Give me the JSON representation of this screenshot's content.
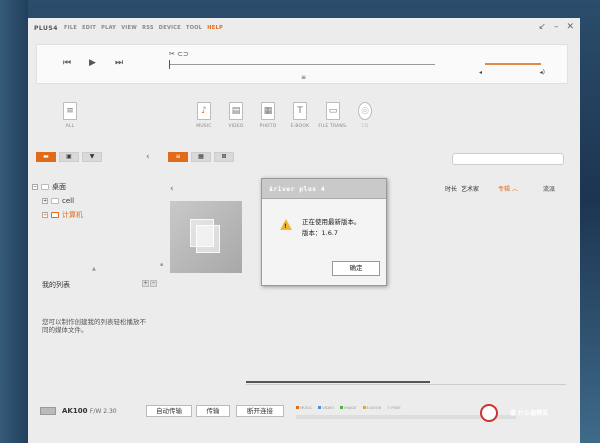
{
  "app": {
    "brand": "PLUS4"
  },
  "menu": [
    {
      "label": "FILE"
    },
    {
      "label": "EDIT"
    },
    {
      "label": "PLAY"
    },
    {
      "label": "VIEW"
    },
    {
      "label": "RSS"
    },
    {
      "label": "DEVICE"
    },
    {
      "label": "TOOL"
    },
    {
      "label": "HELP",
      "active": true
    }
  ],
  "window_controls": {
    "restore": "↙",
    "minimize": "–",
    "close": "✕"
  },
  "player": {
    "prev": "⏮",
    "play": "▶",
    "next": "⏭",
    "seek_icons": "✂ ⊂⊃",
    "seek_mark": "≡",
    "vol_left": "◂",
    "vol_right": "◂)"
  },
  "categories": [
    {
      "label": "ALL",
      "icon": "document-icon",
      "glyph": "≡"
    },
    {
      "label": "MUSIC",
      "icon": "music-icon",
      "glyph": "♪"
    },
    {
      "label": "VIDEO",
      "icon": "video-icon",
      "glyph": "▤"
    },
    {
      "label": "PHOTO",
      "icon": "photo-icon",
      "glyph": "▦"
    },
    {
      "label": "E-BOOK",
      "icon": "ebook-icon",
      "glyph": "T"
    },
    {
      "label": "FILE TRANS.",
      "icon": "file-transfer-icon",
      "glyph": "▭"
    },
    {
      "label": "CD",
      "icon": "cd-icon",
      "glyph": "◎"
    }
  ],
  "left_toolbar": [
    {
      "glyph": "▬",
      "icon": "folder-icon"
    },
    {
      "glyph": "▣",
      "icon": "person-icon"
    },
    {
      "glyph": "▼",
      "icon": "bookmark-icon"
    }
  ],
  "view_toolbar": [
    {
      "glyph": "≡",
      "icon": "list-view-icon"
    },
    {
      "glyph": "▦",
      "icon": "grid-view-icon"
    },
    {
      "glyph": "⊠",
      "icon": "fullscreen-icon"
    }
  ],
  "tree": {
    "desktop": "桌面",
    "cell": "cell",
    "computer": "计算机",
    "expand": "+",
    "collapse": "−"
  },
  "playlist": {
    "title": "我的列表",
    "hint": "您可以制作创建我的列表轻松播放不同的媒体文件。",
    "add": "+",
    "remove": "−"
  },
  "columns": {
    "duration": "时长",
    "artist": "艺术家",
    "album": "专辑 ︿",
    "genre": "流派"
  },
  "status": {
    "device": "AK100",
    "fw": "F/W 2.30",
    "auto": "自动传输",
    "transfer": "传输",
    "disconnect": "断开连接"
  },
  "storage_legend": [
    {
      "label": "MUSIC",
      "color": "#e06c1a"
    },
    {
      "label": "VIDEO",
      "color": "#4f8fd6"
    },
    {
      "label": "IMAGE",
      "color": "#5aa84a"
    },
    {
      "label": "E-BOOK",
      "color": "#d6a83a"
    },
    {
      "label": "FREE",
      "color": "#dddddd"
    }
  ],
  "watermark": "值 什么值得买",
  "dialog": {
    "title": "iriver plus 4",
    "line1": "正在使用最新版本。",
    "line2": "版本：1.6.7",
    "ok": "确定",
    "close": "✕"
  }
}
